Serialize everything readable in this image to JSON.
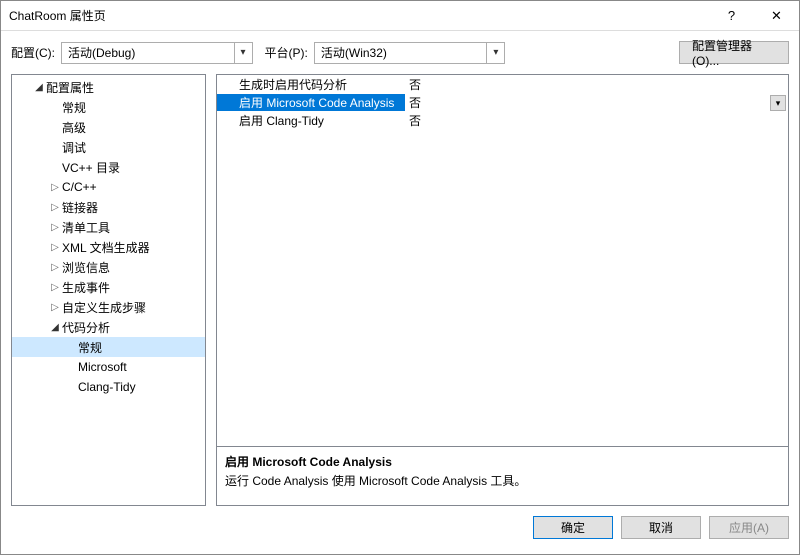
{
  "titlebar": {
    "title": "ChatRoom 属性页",
    "help": "?",
    "close": "✕"
  },
  "topbar": {
    "config_label": "配置(C):",
    "config_value": "活动(Debug)",
    "platform_label": "平台(P):",
    "platform_value": "活动(Win32)",
    "manager_button": "配置管理器(O)..."
  },
  "tree": [
    {
      "level": 1,
      "caret": "filled",
      "label": "配置属性"
    },
    {
      "level": 2,
      "caret": "",
      "label": "常规"
    },
    {
      "level": 2,
      "caret": "",
      "label": "高级"
    },
    {
      "level": 2,
      "caret": "",
      "label": "调试"
    },
    {
      "level": 2,
      "caret": "",
      "label": "VC++ 目录"
    },
    {
      "level": 2,
      "caret": "open",
      "label": "C/C++"
    },
    {
      "level": 2,
      "caret": "open",
      "label": "链接器"
    },
    {
      "level": 2,
      "caret": "open",
      "label": "清单工具"
    },
    {
      "level": 2,
      "caret": "open",
      "label": "XML 文档生成器"
    },
    {
      "level": 2,
      "caret": "open",
      "label": "浏览信息"
    },
    {
      "level": 2,
      "caret": "open",
      "label": "生成事件"
    },
    {
      "level": 2,
      "caret": "open",
      "label": "自定义生成步骤"
    },
    {
      "level": 2,
      "caret": "filled",
      "label": "代码分析"
    },
    {
      "level": 3,
      "caret": "",
      "label": "常规",
      "selected": true
    },
    {
      "level": 3,
      "caret": "",
      "label": "Microsoft"
    },
    {
      "level": 3,
      "caret": "",
      "label": "Clang-Tidy"
    }
  ],
  "grid": {
    "rows": [
      {
        "label": "生成时启用代码分析",
        "value": "否",
        "selected": false
      },
      {
        "label": "启用 Microsoft Code Analysis",
        "value": "否",
        "selected": true
      },
      {
        "label": "启用 Clang-Tidy",
        "value": "否",
        "selected": false
      }
    ]
  },
  "description": {
    "title": "启用 Microsoft Code Analysis",
    "text": "运行 Code Analysis 使用 Microsoft Code Analysis 工具。"
  },
  "buttons": {
    "ok": "确定",
    "cancel": "取消",
    "apply": "应用(A)"
  }
}
